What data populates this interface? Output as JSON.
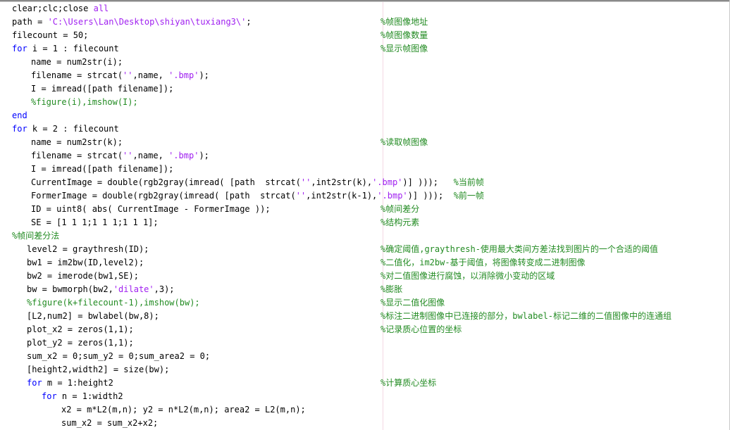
{
  "editor": {
    "colors": {
      "keyword": "#0000ff",
      "string": "#a020f0",
      "comment": "#228b22",
      "text": "#000000"
    },
    "lines": [
      {
        "segs": [
          {
            "t": "txt",
            "v": "clear;clc;close "
          },
          {
            "t": "kw2",
            "v": "all"
          }
        ]
      },
      {
        "segs": [
          {
            "t": "txt",
            "v": "path = "
          },
          {
            "t": "str",
            "v": "'C:\\Users\\Lan\\Desktop\\shiyan\\tuxiang3\\'"
          },
          {
            "t": "txt",
            "v": ";"
          }
        ],
        "comment": "%帧图像地址"
      },
      {
        "segs": [
          {
            "t": "txt",
            "v": "filecount = 50;"
          }
        ],
        "comment": "%帧图像数量"
      },
      {
        "segs": [
          {
            "t": "kw",
            "v": "for"
          },
          {
            "t": "txt",
            "v": " i = 1 : filecount"
          }
        ],
        "comment": "%显示帧图像"
      },
      {
        "segs": [
          {
            "t": "txt",
            "v": "name = num2str(i);"
          }
        ]
      },
      {
        "segs": [
          {
            "t": "txt",
            "v": "filename = strcat("
          },
          {
            "t": "str",
            "v": "''"
          },
          {
            "t": "txt",
            "v": ",name, "
          },
          {
            "t": "str",
            "v": "'.bmp'"
          },
          {
            "t": "txt",
            "v": ");"
          }
        ]
      },
      {
        "segs": [
          {
            "t": "txt",
            "v": "I = imread([path filename]);"
          }
        ]
      },
      {
        "segs": [
          {
            "t": "cmt",
            "v": "%figure(i),imshow(I);"
          }
        ]
      },
      {
        "segs": [
          {
            "t": "kw",
            "v": "end"
          }
        ]
      },
      {
        "segs": [
          {
            "t": "kw",
            "v": "for"
          },
          {
            "t": "txt",
            "v": " k = 2 : filecount"
          }
        ]
      },
      {
        "segs": [
          {
            "t": "txt",
            "v": "name = num2str(k);"
          }
        ],
        "comment": "%读取帧图像"
      },
      {
        "segs": [
          {
            "t": "txt",
            "v": "filename = strcat("
          },
          {
            "t": "str",
            "v": "''"
          },
          {
            "t": "txt",
            "v": ",name, "
          },
          {
            "t": "str",
            "v": "'.bmp'"
          },
          {
            "t": "txt",
            "v": ");"
          }
        ]
      },
      {
        "segs": [
          {
            "t": "txt",
            "v": "I = imread([path filename]);"
          }
        ]
      },
      {
        "segs": [
          {
            "t": "txt",
            "v": "CurrentImage = double(rgb2gray(imread( [path  strcat("
          },
          {
            "t": "str",
            "v": "''"
          },
          {
            "t": "txt",
            "v": ",int2str(k),"
          },
          {
            "t": "str",
            "v": "'.bmp'"
          },
          {
            "t": "txt",
            "v": ")] )));   "
          },
          {
            "t": "cmt",
            "v": "%当前帧"
          }
        ]
      },
      {
        "segs": [
          {
            "t": "txt",
            "v": "FormerImage = double(rgb2gray(imread( [path  strcat("
          },
          {
            "t": "str",
            "v": "''"
          },
          {
            "t": "txt",
            "v": ",int2str(k-1),"
          },
          {
            "t": "str",
            "v": "'.bmp'"
          },
          {
            "t": "txt",
            "v": ")] )));  "
          },
          {
            "t": "cmt",
            "v": "%前一帧"
          }
        ]
      },
      {
        "segs": [
          {
            "t": "txt",
            "v": "ID = uint8( abs( CurrentImage - FormerImage ));"
          }
        ],
        "comment": "%帧间差分"
      },
      {
        "segs": [
          {
            "t": "txt",
            "v": "SE = [1 1 1;1 1 1;1 1 1];"
          }
        ],
        "comment": "%结构元素"
      },
      {
        "segs": [
          {
            "t": "cmt",
            "v": "%帧间差分法"
          }
        ]
      },
      {
        "segs": [
          {
            "t": "txt",
            "v": "level2 = graythresh(ID);"
          }
        ],
        "comment": "%确定阈值,graythresh-使用最大类间方差法找到图片的一个合适的阈值"
      },
      {
        "segs": [
          {
            "t": "txt",
            "v": "bw1 = im2bw(ID,level2);"
          }
        ],
        "comment": "%二值化，im2bw-基于阈值，将图像转变成二进制图像"
      },
      {
        "segs": [
          {
            "t": "txt",
            "v": "bw2 = imerode(bw1,SE);"
          }
        ],
        "comment": "%对二值图像进行腐蚀，以消除微小变动的区域"
      },
      {
        "segs": [
          {
            "t": "txt",
            "v": "bw = bwmorph(bw2,"
          },
          {
            "t": "str",
            "v": "'dilate'"
          },
          {
            "t": "txt",
            "v": ",3);"
          }
        ],
        "comment": "%膨胀"
      },
      {
        "segs": [
          {
            "t": "cmt",
            "v": "%figure(k+filecount-1),imshow(bw);"
          }
        ],
        "comment": "%显示二值化图像"
      },
      {
        "segs": [
          {
            "t": "txt",
            "v": "[L2,num2] = bwlabel(bw,8);"
          }
        ],
        "comment": "%标注二进制图像中已连接的部分，bwlabel-标记二维的二值图像中的连通组"
      },
      {
        "segs": [
          {
            "t": "txt",
            "v": "plot_x2 = zeros(1,1);"
          }
        ],
        "comment": "%记录质心位置的坐标"
      },
      {
        "segs": [
          {
            "t": "txt",
            "v": "plot_y2 = zeros(1,1);"
          }
        ]
      },
      {
        "segs": [
          {
            "t": "txt",
            "v": "sum_x2 = 0;sum_y2 = 0;sum_area2 = 0;"
          }
        ]
      },
      {
        "segs": [
          {
            "t": "txt",
            "v": "[height2,width2] = size(bw);"
          }
        ]
      },
      {
        "segs": [
          {
            "t": "kw",
            "v": "for"
          },
          {
            "t": "txt",
            "v": " m = 1:height2"
          }
        ],
        "comment": "%计算质心坐标"
      },
      {
        "segs": [
          {
            "t": "kw",
            "v": "for"
          },
          {
            "t": "txt",
            "v": " n = 1:width2"
          }
        ]
      },
      {
        "segs": [
          {
            "t": "txt",
            "v": "x2 = m*L2(m,n); y2 = n*L2(m,n); area2 = L2(m,n);"
          }
        ]
      },
      {
        "segs": [
          {
            "t": "txt",
            "v": "sum_x2 = sum_x2+x2;"
          }
        ]
      }
    ]
  }
}
